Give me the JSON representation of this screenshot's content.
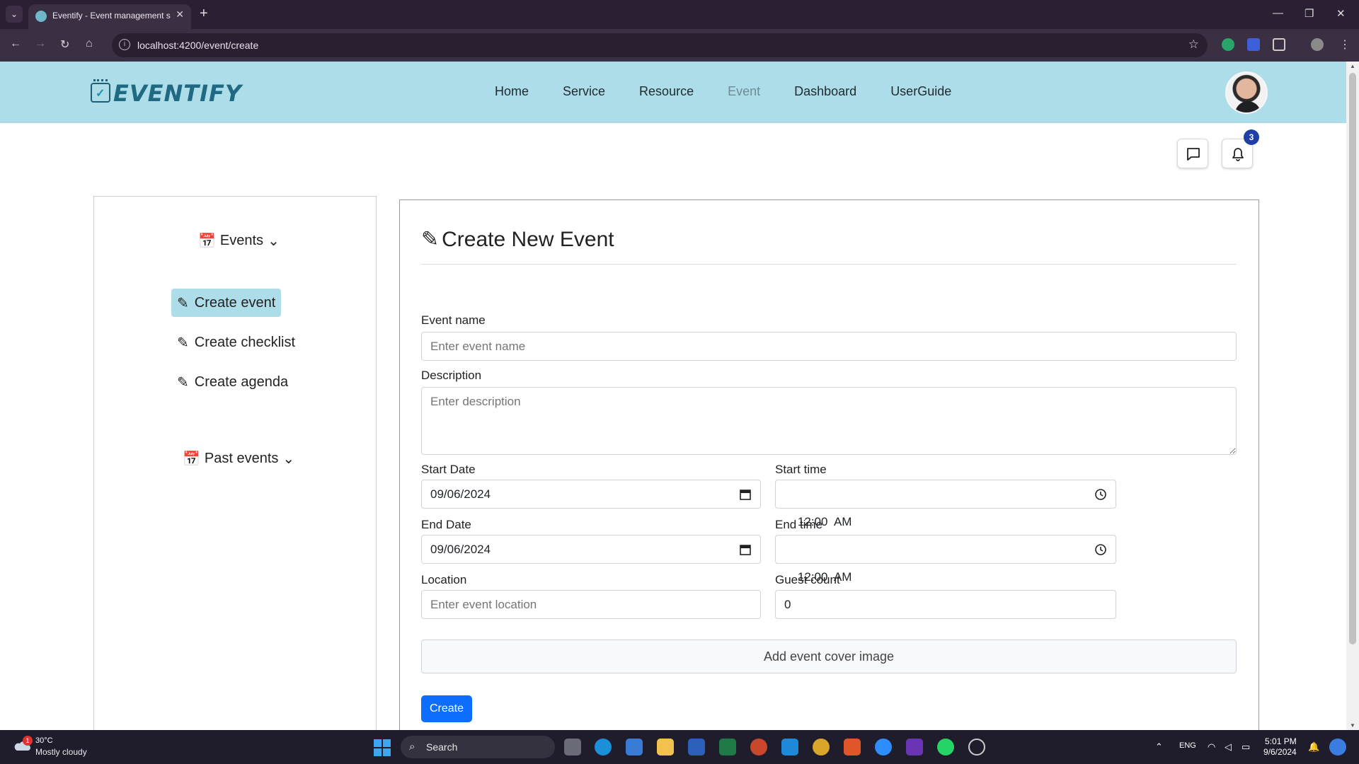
{
  "browser": {
    "tab_title": "Eventify - Event management s",
    "url": "localhost:4200/event/create"
  },
  "app": {
    "logo_text": "EVENTIFY",
    "nav": [
      {
        "label": "Home"
      },
      {
        "label": "Service"
      },
      {
        "label": "Resource"
      },
      {
        "label": "Event",
        "active": true
      },
      {
        "label": "Dashboard"
      },
      {
        "label": "UserGuide"
      }
    ],
    "notification_count": "3",
    "accent_color": "#addde8"
  },
  "sidebar": {
    "events_header": "Events",
    "items": [
      {
        "label": "Create event",
        "active": true
      },
      {
        "label": "Create checklist"
      },
      {
        "label": "Create agenda"
      }
    ],
    "past_events_header": "Past events"
  },
  "form": {
    "title": "Create New Event",
    "event_name": {
      "label": "Event name",
      "placeholder": "Enter event name"
    },
    "description": {
      "label": "Description",
      "placeholder": "Enter description"
    },
    "start_date": {
      "label": "Start Date",
      "value": "09/06/2024"
    },
    "start_time": {
      "label": "Start time",
      "value": "12:00  AM"
    },
    "end_date": {
      "label": "End Date",
      "value": "09/06/2024"
    },
    "end_time": {
      "label": "End time",
      "value": "12:00  AM"
    },
    "location": {
      "label": "Location",
      "placeholder": "Enter event location"
    },
    "guest_count": {
      "label": "Guest count",
      "value": "0"
    },
    "cover_button": "Add event cover image",
    "submit_button": "Create"
  },
  "taskbar": {
    "weather_temp": "30°C",
    "weather_desc": "Mostly cloudy",
    "weather_badge": "1",
    "search_label": "Search",
    "language": "ENG",
    "time": "5:01 PM",
    "date": "9/6/2024"
  }
}
